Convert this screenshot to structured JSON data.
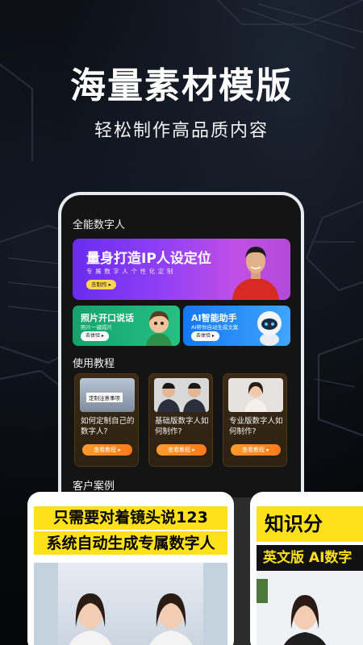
{
  "hero": {
    "title": "海量素材模版",
    "subtitle": "轻松制作高品质内容"
  },
  "app": {
    "section_digital_human": "全能数字人",
    "banner": {
      "title": "量身打造IP人设定位",
      "subtitle": "专属数字人个性化定制",
      "button": "去制作 ▸"
    },
    "cards": [
      {
        "title": "照片开口说话",
        "subtitle": "照片一键成片",
        "button": "去体验 ▸"
      },
      {
        "title": "AI智能助手",
        "subtitle": "AI帮你自动生成文案",
        "button": "去体验 ▸"
      }
    ],
    "section_tutorials": "使用教程",
    "tutorials": [
      {
        "title": "如何定制自己的数字人?",
        "button": "查看教程 ▸",
        "thumb_text": "定制注意事项"
      },
      {
        "title": "基础版数字人如何制作?",
        "button": "查看教程 ▸"
      },
      {
        "title": "专业版数字人如何制作?",
        "button": "查看教程 ▸"
      }
    ],
    "section_cases": "客户案例"
  },
  "showcase": {
    "a_line1": "只需要对着镜头说123",
    "a_line2": "系统自动生成专属数字人",
    "b_line1": "知识分",
    "b_line2": "英文版 AI数字"
  },
  "colors": {
    "accent_yellow": "#ffe11b",
    "tutorial_button": "#ff8a22",
    "banner_purple": "#8f3ff5",
    "card_green": "#1bb074",
    "card_blue": "#2d8ef8"
  }
}
